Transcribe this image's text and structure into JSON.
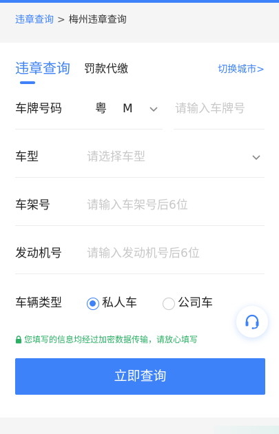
{
  "breadcrumb": {
    "link": "违章查询",
    "separator": ">",
    "current": "梅州违章查询"
  },
  "tabs": {
    "active": "违章查询",
    "other": "罚款代缴",
    "switch_city": "切换城市>"
  },
  "form": {
    "plate": {
      "label": "车牌号码",
      "province": "粤",
      "letter": "M",
      "placeholder": "请输入车牌号"
    },
    "vehicle_type": {
      "label": "车型",
      "placeholder": "请选择车型"
    },
    "frame": {
      "label": "车架号",
      "placeholder": "请输入车架号后6位"
    },
    "engine": {
      "label": "发动机号",
      "placeholder": "请输入发动机号后6位"
    },
    "owner_type": {
      "label": "车辆类型",
      "options": [
        "私人车",
        "公司车"
      ],
      "selected": "私人车"
    }
  },
  "notice": "您填写的信息均经过加密数据传输，请放心填写",
  "submit_label": "立即查询",
  "icons": {
    "lock": "lock-icon",
    "chevron": "chevron-down-icon",
    "support": "headset-icon"
  },
  "colors": {
    "accent": "#3d82f8",
    "notice": "#27b062",
    "placeholder": "#c8c8c8"
  }
}
